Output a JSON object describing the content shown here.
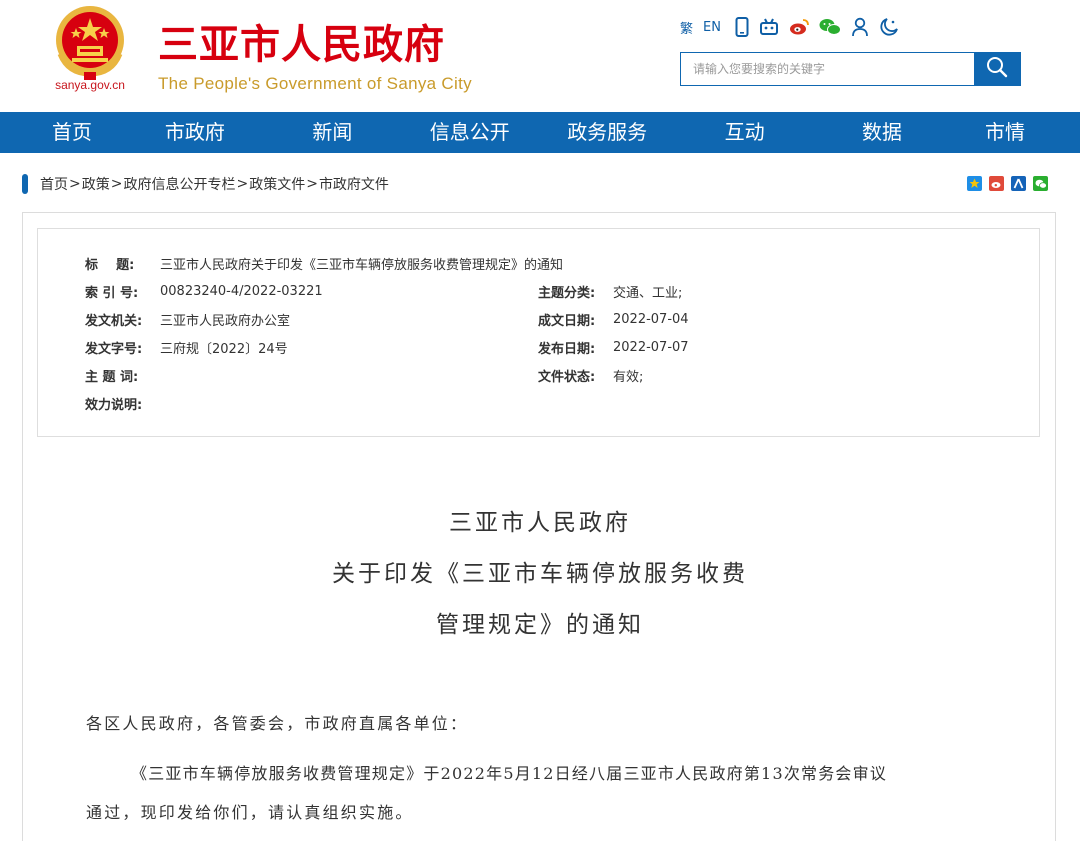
{
  "header": {
    "domain": "sanya.gov.cn",
    "brand_cn": "三亚市人民政府",
    "brand_en": "The People's Government of Sanya City",
    "tools": {
      "traditional": "繁",
      "english": "EN"
    },
    "search": {
      "placeholder": "请输入您要搜索的关键字"
    }
  },
  "nav": {
    "items": [
      "首页",
      "市政府",
      "新闻",
      "信息公开",
      "政务服务",
      "互动",
      "数据",
      "市情"
    ]
  },
  "breadcrumb": {
    "items": [
      "首页",
      "政策",
      "政府信息公开专栏",
      "政策文件",
      "市政府文件"
    ],
    "separator": ">"
  },
  "meta": {
    "title_label": "标    题:",
    "title_value": "三亚市人民政府关于印发《三亚市车辆停放服务收费管理规定》的通知",
    "index_label": "索 引 号:",
    "index_value": "00823240-4/2022-03221",
    "topic_label": "主题分类:",
    "topic_value": "交通、工业;",
    "issuer_label": "发文机关:",
    "issuer_value": "三亚市人民政府办公室",
    "created_label": "成文日期:",
    "created_value": "2022-07-04",
    "docno_label": "发文字号:",
    "docno_value": "三府规〔2022〕24号",
    "published_label": "发布日期:",
    "published_value": "2022-07-07",
    "keywords_label": "主 题 词:",
    "status_label": "文件状态:",
    "status_value": "有效;",
    "validity_label": "效力说明:"
  },
  "document": {
    "title_line1": "三亚市人民政府",
    "title_line2": "关于印发《三亚市车辆停放服务收费",
    "title_line3": "管理规定》的通知",
    "salutation": "各区人民政府，各管委会，市政府直属各单位：",
    "para1_line1": "《三亚市车辆停放服务收费管理规定》于2022年5月12日经八届三亚市人民政府第13次常务会审议",
    "para1_line2": "通过，现印发给你们，请认真组织实施。"
  },
  "colors": {
    "brand_red": "#d7000f",
    "brand_gold": "#c99b2b",
    "nav_blue": "#0f67b1"
  }
}
